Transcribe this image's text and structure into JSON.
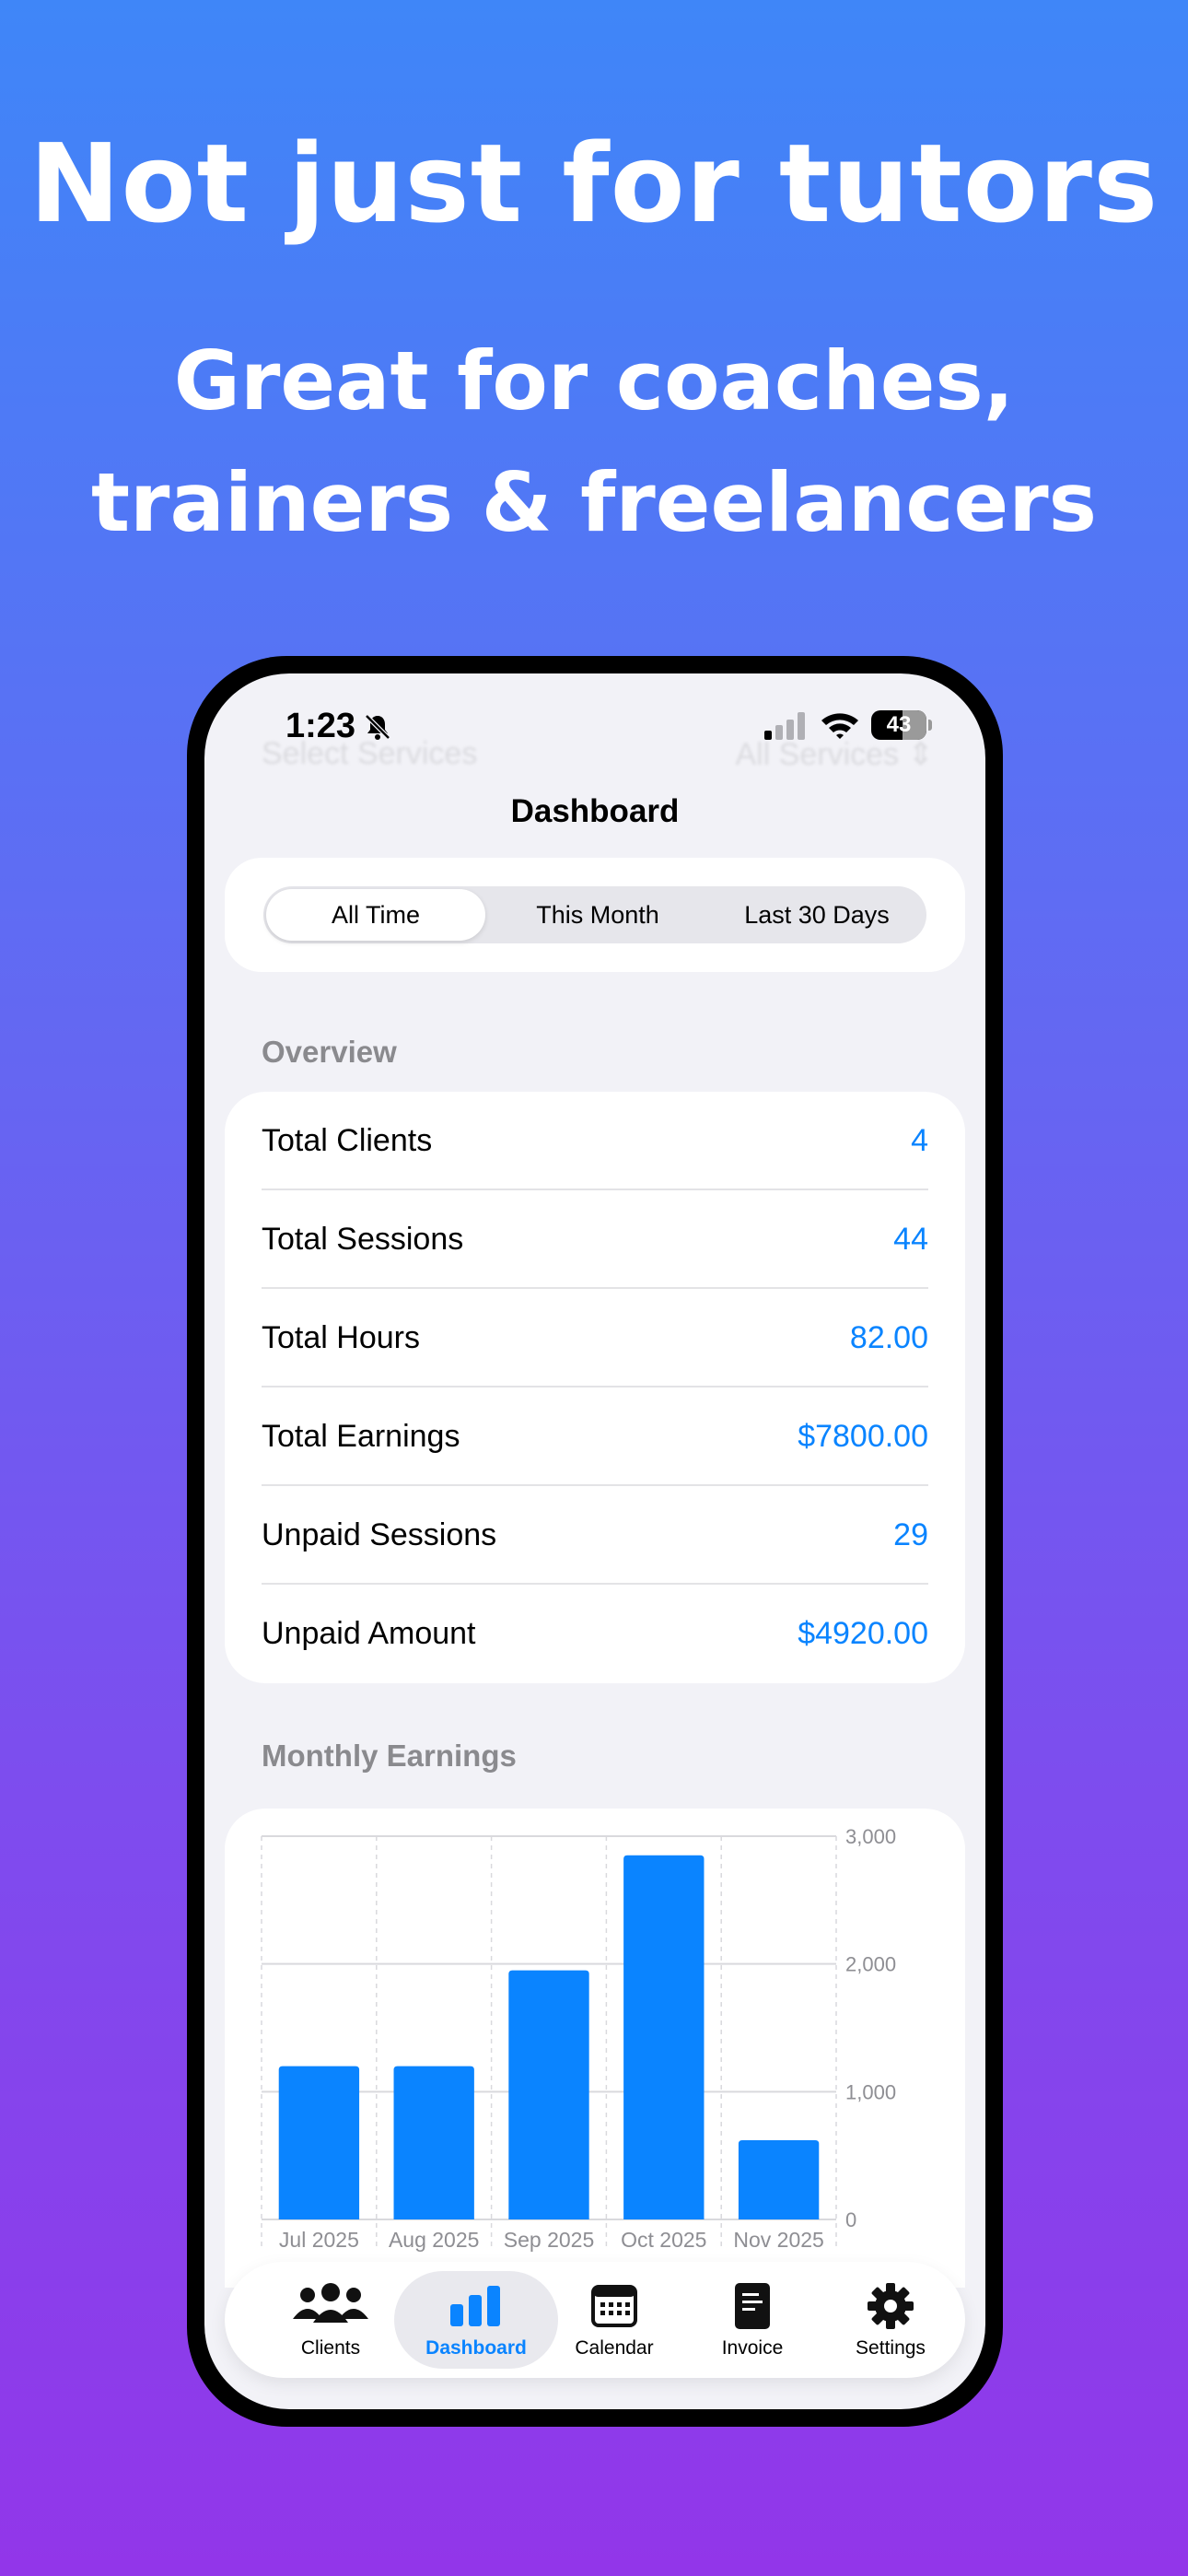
{
  "promo": {
    "headline": "Not just for tutors",
    "subheadline_line1": "Great for coaches,",
    "subheadline_line2": "trainers & freelancers"
  },
  "status_bar": {
    "time": "1:23",
    "battery": "43"
  },
  "ghost_header": {
    "left": "Select Services",
    "right": "All Services ⇕"
  },
  "nav": {
    "title": "Dashboard"
  },
  "segments": {
    "items": [
      "All Time",
      "This Month",
      "Last 30 Days"
    ],
    "selected": "All Time"
  },
  "overview": {
    "label": "Overview",
    "rows": [
      {
        "label": "Total Clients",
        "value": "4"
      },
      {
        "label": "Total Sessions",
        "value": "44"
      },
      {
        "label": "Total Hours",
        "value": "82.00"
      },
      {
        "label": "Total Earnings",
        "value": "$7800.00"
      },
      {
        "label": "Unpaid Sessions",
        "value": "29"
      },
      {
        "label": "Unpaid Amount",
        "value": "$4920.00"
      }
    ]
  },
  "monthly": {
    "label": "Monthly Earnings"
  },
  "chart_data": {
    "type": "bar",
    "categories": [
      "Jul 2025",
      "Aug 2025",
      "Sep 2025",
      "Oct 2025",
      "Nov 2025"
    ],
    "values": [
      1200,
      1200,
      1950,
      2850,
      620
    ],
    "ylim": [
      0,
      3000
    ],
    "yticks": [
      0,
      1000,
      2000,
      3000
    ],
    "ytick_labels": [
      "0",
      "1,000",
      "2,000",
      "3,000"
    ],
    "grid": true,
    "bar_color": "#0a84ff"
  },
  "tabs": [
    {
      "label": "Clients",
      "icon": "people-icon"
    },
    {
      "label": "Dashboard",
      "icon": "bar-chart-icon"
    },
    {
      "label": "Calendar",
      "icon": "calendar-icon"
    },
    {
      "label": "Invoice",
      "icon": "invoice-icon"
    },
    {
      "label": "Settings",
      "icon": "gear-icon"
    }
  ],
  "active_tab": "Dashboard",
  "colors": {
    "accent": "#0a84ff",
    "background": "#f2f2f7"
  }
}
